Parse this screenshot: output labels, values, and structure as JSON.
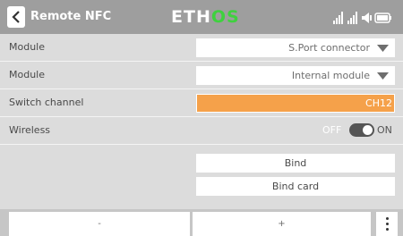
{
  "header": {
    "title": "Remote NFC",
    "brand_main": "ETH",
    "brand_accent": "OS",
    "accent_color": "#3fd13f"
  },
  "rows": [
    {
      "label": "Module",
      "value": "S.Port connector"
    },
    {
      "label": "Module",
      "value": "Internal module"
    },
    {
      "label": "Switch channel",
      "value": "CH12"
    },
    {
      "label": "Wireless",
      "off_label": "OFF",
      "on_label": "ON",
      "state": "on"
    },
    {
      "label": ""
    }
  ],
  "buttons": {
    "bind": "Bind",
    "bind_card": "Bind card"
  },
  "footer": {
    "minus": "-",
    "plus": "+"
  },
  "icons": {
    "back": "chevron-left-icon",
    "dropdown": "triangle-down-icon",
    "menu": "vertical-dots-icon",
    "status": [
      "signal-icon",
      "signal-icon",
      "speaker-icon",
      "battery-icon"
    ]
  },
  "colors": {
    "header_bg": "#9e9e9e",
    "selected_field": "#f5a14a"
  }
}
